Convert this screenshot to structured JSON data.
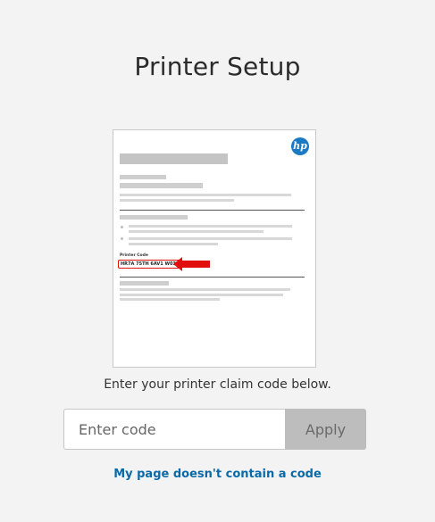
{
  "page": {
    "title": "Printer Setup",
    "instruction": "Enter your printer claim code below."
  },
  "printout": {
    "logo_text": "hp",
    "printer_code_label": "Printer Code",
    "printer_code_value": "HR7A 75TH 6AV1 W034",
    "highlight_color": "#e10e0e",
    "logo_color": "#1a7ac4"
  },
  "form": {
    "code_placeholder": "Enter code",
    "code_value": "",
    "apply_label": "Apply"
  },
  "links": {
    "no_code": "My page doesn't contain a code"
  },
  "colors": {
    "link": "#0a6aa8",
    "apply_disabled_bg": "#bdbdbd"
  }
}
